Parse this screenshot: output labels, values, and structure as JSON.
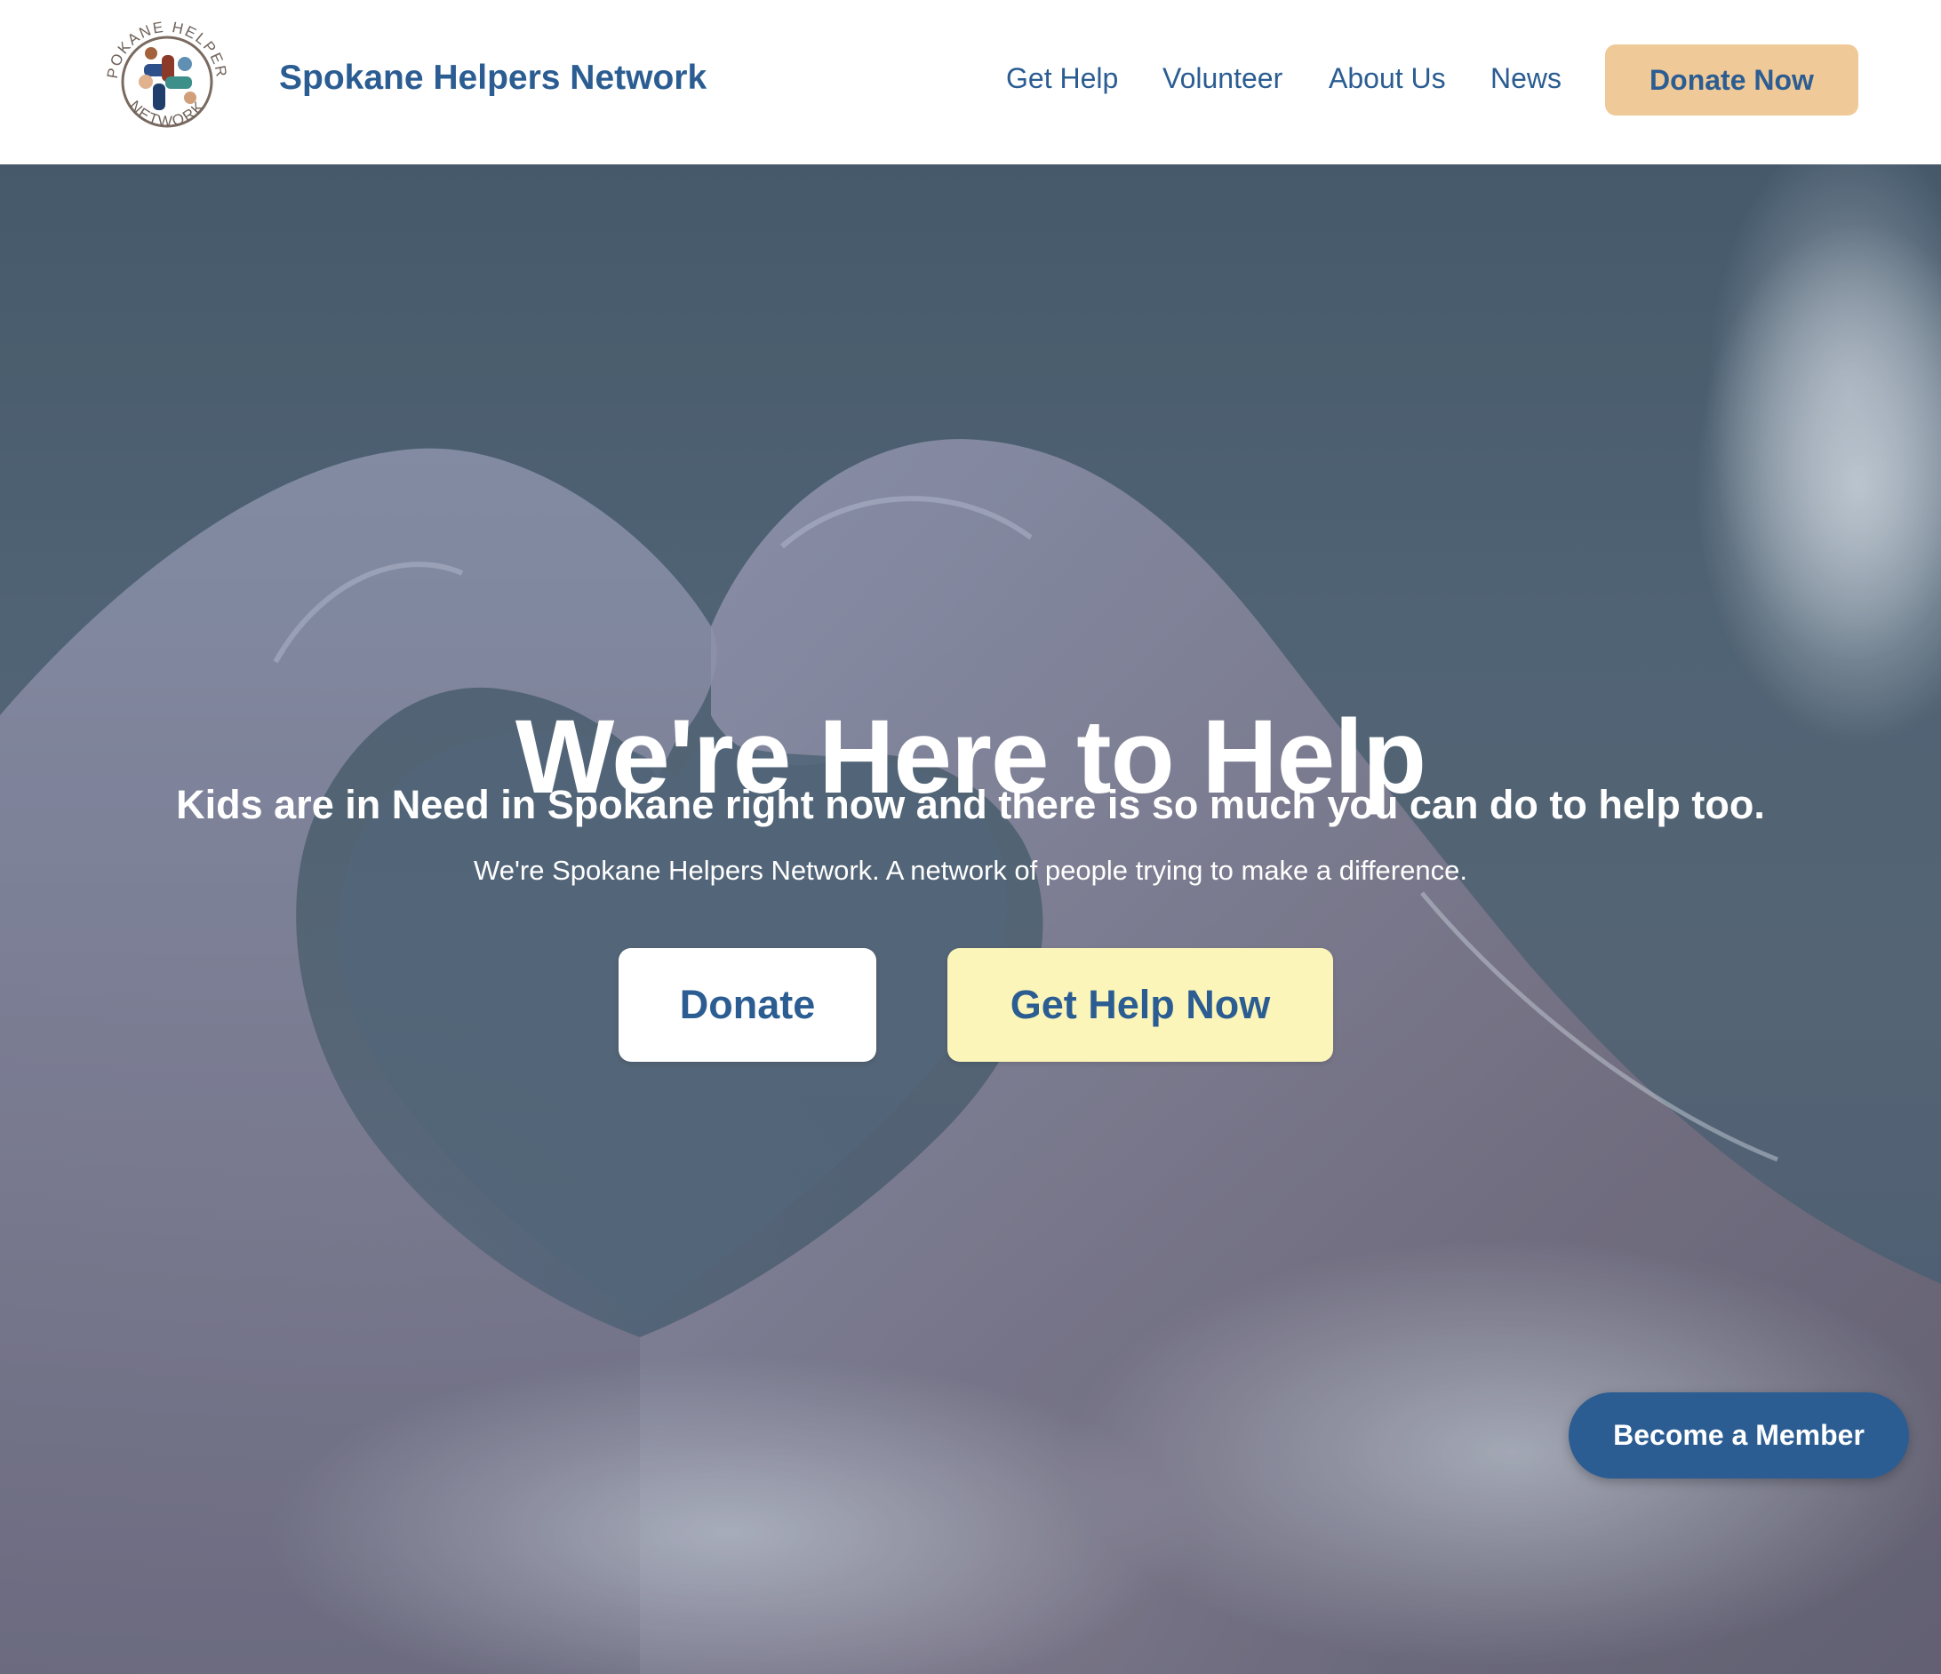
{
  "header": {
    "logo": {
      "icon": "hands-circle-logo",
      "ring_text_top": "SPOKANE HELPERS",
      "ring_text_bottom": "NETWORK"
    },
    "brand_name": "Spokane Helpers Network",
    "nav": {
      "get_help": "Get Help",
      "volunteer": "Volunteer",
      "about_us": "About Us",
      "news": "News"
    },
    "donate_now_label": "Donate Now"
  },
  "hero": {
    "background": "hands-forming-heart-photo",
    "title": "We're Here to Help",
    "subtitle": "Kids are in Need in Spokane right now and there is so much you can do to help too.",
    "description": "We're Spokane Helpers Network. A network of people trying to make a difference.",
    "donate_label": "Donate",
    "get_help_now_label": "Get Help Now"
  },
  "floating": {
    "become_member_label": "Become a Member"
  },
  "colors": {
    "brand_blue": "#2b5d92",
    "donate_now_bg": "#f0c998",
    "get_help_bg": "#fcf5b9",
    "white": "#ffffff"
  }
}
